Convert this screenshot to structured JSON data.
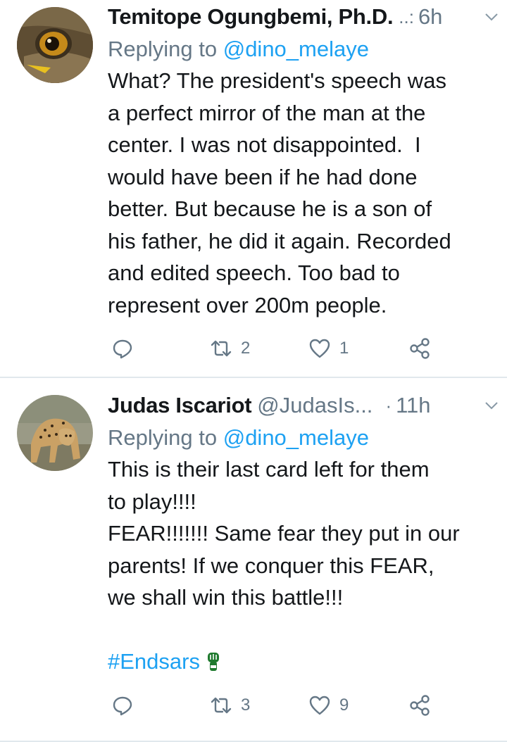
{
  "tweets": [
    {
      "name": "Temitope Ogungbemi, Ph.D.",
      "handle": "",
      "truncation": "..:",
      "time": "6h",
      "reply_prefix": "Replying to",
      "reply_mention": "@dino_melaye",
      "text": "What? The president's speech was\na perfect mirror of the man at the\ncenter. I was not disappointed.  I\nwould have been if he had done\nbetter. But because he is a son of\nhis father, he did it again. Recorded\nand edited speech. Too bad to\nrepresent over 200m people.",
      "retweets": "2",
      "likes": "1",
      "avatar_icon": "eagle-eye-avatar"
    },
    {
      "name": "Judas Iscariot",
      "handle": "@JudasIs...",
      "truncation": "·",
      "time": "11h",
      "reply_prefix": "Replying to",
      "reply_mention": "@dino_melaye",
      "text": "This is their last card left for them\nto play!!!!\nFEAR!!!!!!! Same fear they put in our\nparents! If we conquer this FEAR,\nwe shall win this battle!!!\n\n",
      "hashtag": "#Endsars",
      "retweets": "3",
      "likes": "9",
      "avatar_icon": "cheetah-avatar"
    }
  ],
  "colors": {
    "accent": "#1da1f2",
    "muted": "#657786",
    "text": "#14171a",
    "divider": "#e1e8ed"
  },
  "icons": [
    "reply-icon",
    "retweet-icon",
    "like-icon",
    "share-icon",
    "chevron-down-icon",
    "raised-fist-emoji"
  ]
}
